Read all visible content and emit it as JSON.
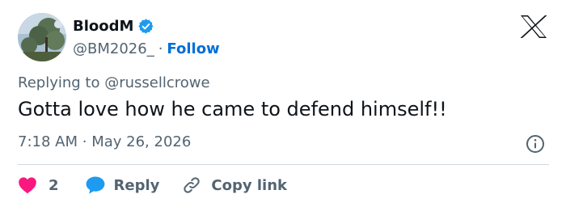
{
  "author": {
    "display_name": "BloodM",
    "handle": "@BM2026_",
    "separator": "·",
    "follow_label": "Follow"
  },
  "tweet": {
    "replying_prefix": "Replying to",
    "replying_to": "@russellcrowe",
    "text": "Gotta love how he came to defend himself!!",
    "time": "7:18 AM",
    "date": "May 26, 2026",
    "meta_separator": "·"
  },
  "actions": {
    "like_count": "2",
    "reply_label": "Reply",
    "copy_link_label": "Copy link"
  },
  "icons": {
    "verified": "verified-badge-icon",
    "platform": "x-logo-icon",
    "info": "info-icon",
    "like": "heart-icon",
    "reply": "speech-bubble-icon",
    "copy": "link-icon"
  },
  "colors": {
    "link_blue": "#006fd6",
    "verified_blue": "#1d9bf0",
    "heart_pink": "#f91880",
    "secondary_text": "#536471",
    "primary_text": "#0f1419"
  }
}
